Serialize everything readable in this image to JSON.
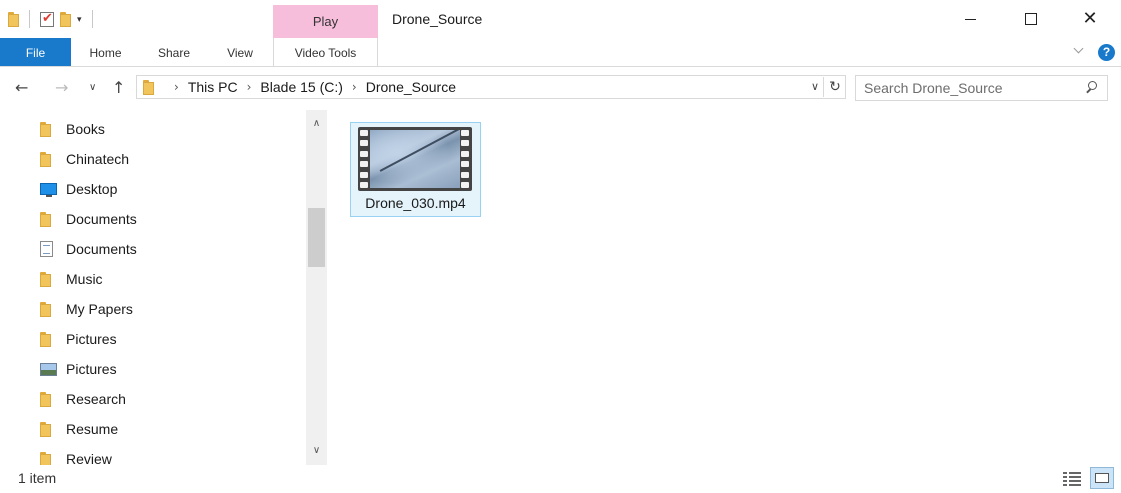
{
  "window": {
    "title": "Drone_Source",
    "context_tab_header": "Play",
    "controls": {
      "minimize": "minimize-icon",
      "maximize": "maximize-icon",
      "close": "close-icon",
      "close_glyph": "✕"
    }
  },
  "quick_access_toolbar": {
    "items": [
      "folder-icon",
      "properties-icon",
      "new-folder-icon",
      "customize-dropdown-icon"
    ],
    "dropdown_glyph": "▾"
  },
  "ribbon": {
    "tabs": [
      {
        "label": "File",
        "active": true
      },
      {
        "label": "Home"
      },
      {
        "label": "Share"
      },
      {
        "label": "View"
      },
      {
        "label": "Video Tools"
      }
    ],
    "help_glyph": "?"
  },
  "navigation": {
    "back_glyph": "←",
    "forward_glyph": "→",
    "recent_glyph": "∨",
    "up_glyph": "↑",
    "breadcrumb": [
      "This PC",
      "Blade 15 (C:)",
      "Drone_Source"
    ],
    "separator_glyph": "›",
    "address_dropdown_glyph": "∨",
    "refresh_glyph": "↻"
  },
  "search": {
    "placeholder": "Search Drone_Source",
    "value": ""
  },
  "nav_pane": {
    "items": [
      {
        "label": "Books",
        "icon": "folder-icon"
      },
      {
        "label": "Chinatech",
        "icon": "folder-icon"
      },
      {
        "label": "Desktop",
        "icon": "desktop-icon"
      },
      {
        "label": "Documents",
        "icon": "folder-icon"
      },
      {
        "label": "Documents",
        "icon": "documents-library-icon"
      },
      {
        "label": "Music",
        "icon": "folder-icon"
      },
      {
        "label": "My Papers",
        "icon": "folder-icon"
      },
      {
        "label": "Pictures",
        "icon": "folder-icon"
      },
      {
        "label": "Pictures",
        "icon": "pictures-library-icon"
      },
      {
        "label": "Research",
        "icon": "folder-icon"
      },
      {
        "label": "Resume",
        "icon": "folder-icon"
      },
      {
        "label": "Review",
        "icon": "folder-icon"
      }
    ],
    "scroll_up_glyph": "∧",
    "scroll_down_glyph": "∨"
  },
  "files": [
    {
      "name": "Drone_030.mp4",
      "icon": "video-thumbnail",
      "selected": true
    }
  ],
  "status": {
    "item_count": "1 item",
    "view_modes": [
      "details-view-icon",
      "large-icons-view-icon"
    ],
    "active_view": "large-icons-view-icon"
  },
  "colors": {
    "file_tab": "#1979ca",
    "context_tab": "#f7bedc",
    "selection_fill": "#e5f3fb",
    "selection_border": "#99d1f5"
  }
}
